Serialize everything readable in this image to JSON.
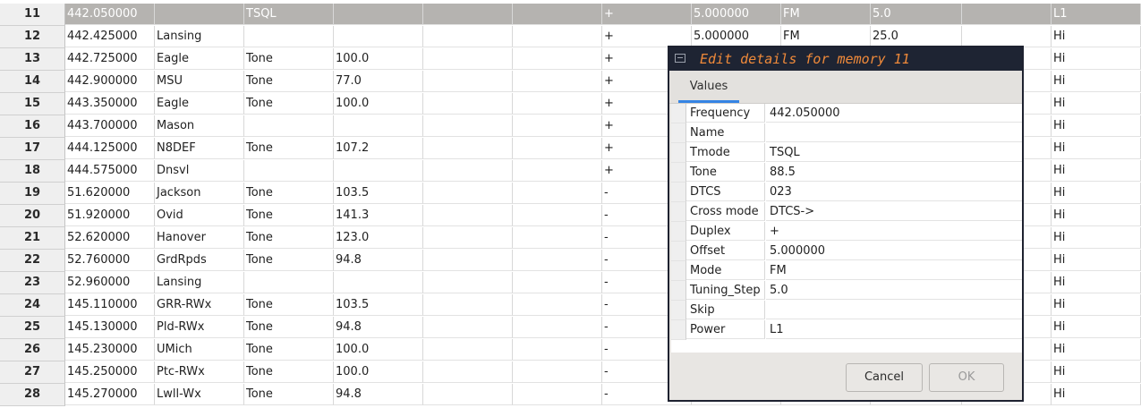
{
  "table": {
    "rows": [
      {
        "num": "11",
        "freq": "442.050000",
        "name": "",
        "tmode": "TSQL",
        "tone": "",
        "c5": "",
        "c6": "",
        "duplex": "+",
        "offset": "5.000000",
        "mode": "FM",
        "step": "5.0",
        "c11": "",
        "power": "L1",
        "selected": true
      },
      {
        "num": "12",
        "freq": "442.425000",
        "name": "Lansing",
        "tmode": "",
        "tone": "",
        "c5": "",
        "c6": "",
        "duplex": "+",
        "offset": "5.000000",
        "mode": "FM",
        "step": "25.0",
        "c11": "",
        "power": "Hi"
      },
      {
        "num": "13",
        "freq": "442.725000",
        "name": "Eagle",
        "tmode": "Tone",
        "tone": "100.0",
        "c5": "",
        "c6": "",
        "duplex": "+",
        "offset": "",
        "mode": "",
        "step": "",
        "c11": "",
        "power": "Hi"
      },
      {
        "num": "14",
        "freq": "442.900000",
        "name": "MSU",
        "tmode": "Tone",
        "tone": "77.0",
        "c5": "",
        "c6": "",
        "duplex": "+",
        "offset": "",
        "mode": "",
        "step": "",
        "c11": "",
        "power": "Hi"
      },
      {
        "num": "15",
        "freq": "443.350000",
        "name": "Eagle",
        "tmode": "Tone",
        "tone": "100.0",
        "c5": "",
        "c6": "",
        "duplex": "+",
        "offset": "",
        "mode": "",
        "step": "",
        "c11": "",
        "power": "Hi"
      },
      {
        "num": "16",
        "freq": "443.700000",
        "name": "Mason",
        "tmode": "",
        "tone": "",
        "c5": "",
        "c6": "",
        "duplex": "+",
        "offset": "",
        "mode": "",
        "step": "",
        "c11": "",
        "power": "Hi"
      },
      {
        "num": "17",
        "freq": "444.125000",
        "name": "N8DEF",
        "tmode": "Tone",
        "tone": "107.2",
        "c5": "",
        "c6": "",
        "duplex": "+",
        "offset": "",
        "mode": "",
        "step": "",
        "c11": "",
        "power": "Hi"
      },
      {
        "num": "18",
        "freq": "444.575000",
        "name": "Dnsvl",
        "tmode": "",
        "tone": "",
        "c5": "",
        "c6": "",
        "duplex": "+",
        "offset": "",
        "mode": "",
        "step": "",
        "c11": "",
        "power": "Hi"
      },
      {
        "num": "19",
        "freq": "51.620000",
        "name": "Jackson",
        "tmode": "Tone",
        "tone": "103.5",
        "c5": "",
        "c6": "",
        "duplex": "-",
        "offset": "",
        "mode": "",
        "step": "",
        "c11": "",
        "power": "Hi"
      },
      {
        "num": "20",
        "freq": "51.920000",
        "name": "Ovid",
        "tmode": "Tone",
        "tone": "141.3",
        "c5": "",
        "c6": "",
        "duplex": "-",
        "offset": "",
        "mode": "",
        "step": "",
        "c11": "",
        "power": "Hi"
      },
      {
        "num": "21",
        "freq": "52.620000",
        "name": "Hanover",
        "tmode": "Tone",
        "tone": "123.0",
        "c5": "",
        "c6": "",
        "duplex": "-",
        "offset": "",
        "mode": "",
        "step": "",
        "c11": "",
        "power": "Hi"
      },
      {
        "num": "22",
        "freq": "52.760000",
        "name": "GrdRpds",
        "tmode": "Tone",
        "tone": "94.8",
        "c5": "",
        "c6": "",
        "duplex": "-",
        "offset": "",
        "mode": "",
        "step": "",
        "c11": "",
        "power": "Hi"
      },
      {
        "num": "23",
        "freq": "52.960000",
        "name": "Lansing",
        "tmode": "",
        "tone": "",
        "c5": "",
        "c6": "",
        "duplex": "-",
        "offset": "",
        "mode": "",
        "step": "",
        "c11": "",
        "power": "Hi"
      },
      {
        "num": "24",
        "freq": "145.110000",
        "name": "GRR-RWx",
        "tmode": "Tone",
        "tone": "103.5",
        "c5": "",
        "c6": "",
        "duplex": "-",
        "offset": "",
        "mode": "",
        "step": "",
        "c11": "",
        "power": "Hi"
      },
      {
        "num": "25",
        "freq": "145.130000",
        "name": "Pld-RWx",
        "tmode": "Tone",
        "tone": "94.8",
        "c5": "",
        "c6": "",
        "duplex": "-",
        "offset": "",
        "mode": "",
        "step": "",
        "c11": "",
        "power": "Hi"
      },
      {
        "num": "26",
        "freq": "145.230000",
        "name": "UMich",
        "tmode": "Tone",
        "tone": "100.0",
        "c5": "",
        "c6": "",
        "duplex": "-",
        "offset": "",
        "mode": "",
        "step": "",
        "c11": "",
        "power": "Hi"
      },
      {
        "num": "27",
        "freq": "145.250000",
        "name": "Ptc-RWx",
        "tmode": "Tone",
        "tone": "100.0",
        "c5": "",
        "c6": "",
        "duplex": "-",
        "offset": "",
        "mode": "",
        "step": "",
        "c11": "",
        "power": "Hi"
      },
      {
        "num": "28",
        "freq": "145.270000",
        "name": "Lwll-Wx",
        "tmode": "Tone",
        "tone": "94.8",
        "c5": "",
        "c6": "",
        "duplex": "-",
        "offset": "",
        "mode": "",
        "step": "",
        "c11": "",
        "power": "Hi"
      }
    ]
  },
  "dialog": {
    "title": "Edit details for memory 11",
    "tab_label": "Values",
    "fields": [
      {
        "label": "Frequency",
        "value": "442.050000"
      },
      {
        "label": "Name",
        "value": ""
      },
      {
        "label": "Tmode",
        "value": "TSQL"
      },
      {
        "label": "Tone",
        "value": "88.5"
      },
      {
        "label": "DTCS",
        "value": "023"
      },
      {
        "label": "Cross mode",
        "value": "DTCS->"
      },
      {
        "label": "Duplex",
        "value": "+"
      },
      {
        "label": "Offset",
        "value": "5.000000"
      },
      {
        "label": "Mode",
        "value": "FM"
      },
      {
        "label": "Tuning_Step",
        "value": "5.0"
      },
      {
        "label": "Skip",
        "value": ""
      },
      {
        "label": "Power",
        "value": "L1"
      }
    ],
    "cancel_label": "Cancel",
    "ok_label": "OK"
  },
  "colors": {
    "accent": "#3584e4",
    "title_text": "#f08a3a",
    "titlebar": "#1e2433",
    "selected_row": "#b5b3b0"
  }
}
